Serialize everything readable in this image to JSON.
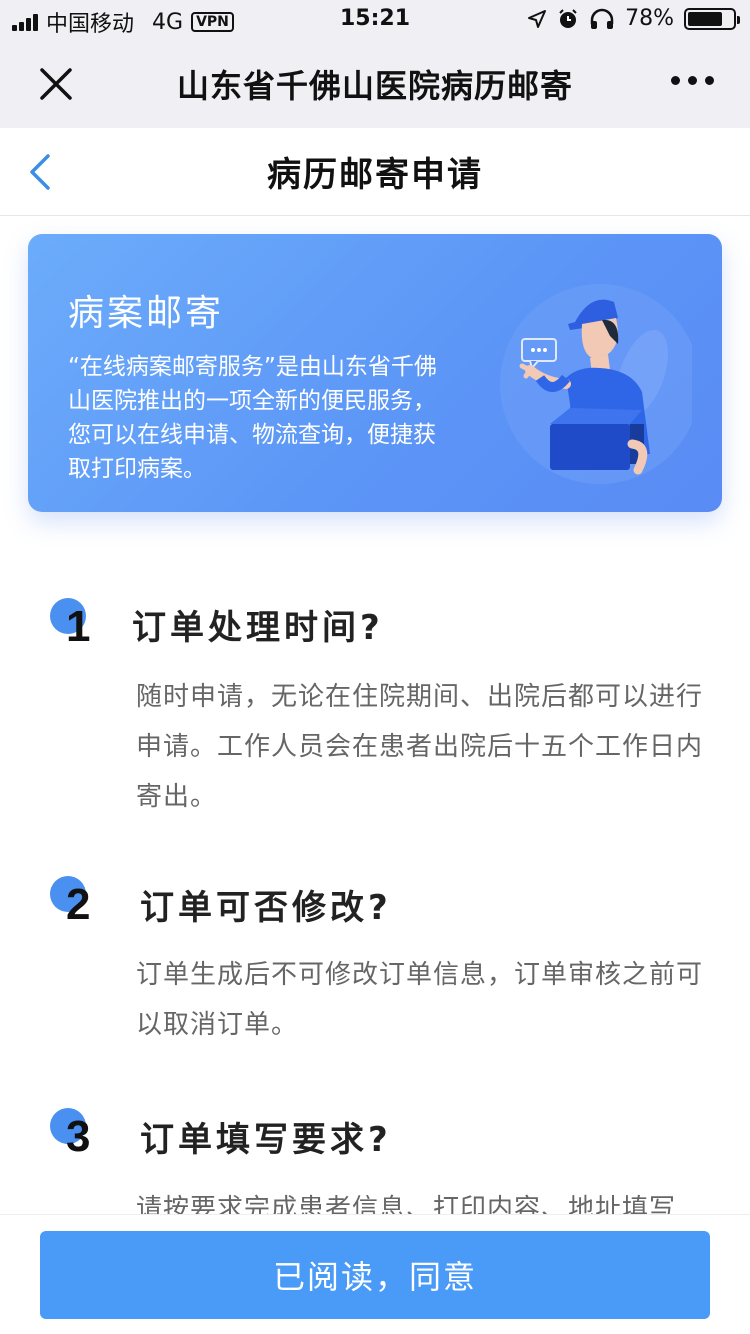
{
  "status_bar": {
    "carrier": "中国移动",
    "network": "4G",
    "vpn": "VPN",
    "time": "15:21",
    "battery": "78%",
    "battery_level": 0.78
  },
  "top_nav": {
    "title": "山东省千佛山医院病历邮寄"
  },
  "page_header": {
    "title": "病历邮寄申请"
  },
  "banner": {
    "title": "病案邮寄",
    "description": "“在线病案邮寄服务”是由山东省千佛山医院推出的一项全新的便民服务，您可以在线申请、物流查询，便捷获取打印病案。"
  },
  "faq": [
    {
      "number": "1",
      "question": "订单处理时间?",
      "answer": "随时申请，无论在住院期间、出院后都可以进行申请。工作人员会在患者出院后十五个工作日内寄出。"
    },
    {
      "number": "2",
      "question": "订单可否修改?",
      "answer": "订单生成后不可修改订单信息，订单审核之前可以取消订单。"
    },
    {
      "number": "3",
      "question": "订单填写要求?",
      "answer": "请按要求完成患者信息、打印内容、地址填写"
    }
  ],
  "bottom": {
    "agree_label": "已阅读，同意"
  },
  "colors": {
    "accent": "#4a9af7",
    "banner_start": "#6cacfb",
    "banner_end": "#5a8bf5",
    "number_dot": "#4a90f0"
  }
}
